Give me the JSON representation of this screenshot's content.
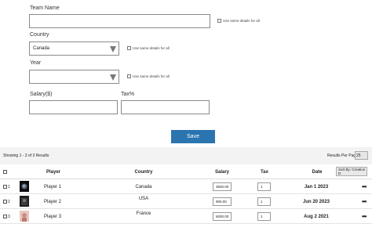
{
  "form": {
    "team_label": "Team Name",
    "team_value": "",
    "team_same": "Use same details for all",
    "country_label": "Country",
    "country_value": "Canada",
    "country_same": "Use same details for all",
    "year_label": "Year",
    "year_value": "",
    "year_same": "Use same details for all",
    "salary_label": "Salary($)",
    "salary_value": "",
    "tax_label": "Tax%",
    "tax_value": "",
    "save_label": "Save"
  },
  "grid": {
    "showing": "Showing 1 - 3 of 3 Results",
    "per_page_label": "Results Per Page:",
    "per_page_value": "25",
    "headers": {
      "player": "Player",
      "country": "Country",
      "salary": "Salary",
      "tax": "Tax",
      "date": "Date",
      "sort": "Sort By: Creation D"
    },
    "rows": [
      {
        "num": "1",
        "player": "Player 1",
        "country": "Canada",
        "salary": "3500.00",
        "tax": "1",
        "date": "Jan 1 2023",
        "more": "•••"
      },
      {
        "num": "2",
        "player": "Player 2",
        "country": "USA",
        "salary": "900.00",
        "tax": "1",
        "date": "Jun 20 2023",
        "more": "•••"
      },
      {
        "num": "3",
        "player": "Player 3",
        "country": "France",
        "salary": "5000.00",
        "tax": "1",
        "date": "Aug 2 2021",
        "more": "•••"
      }
    ]
  },
  "colors": {
    "save_button": "#2a74b0",
    "grid_background": "#f3f3f3"
  }
}
